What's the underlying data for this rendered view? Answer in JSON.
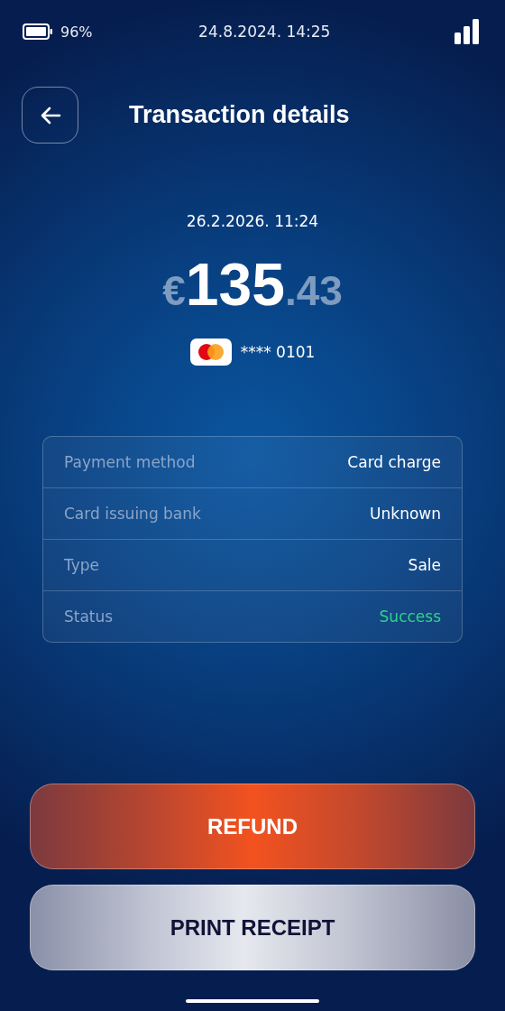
{
  "status_bar": {
    "battery": "96%",
    "datetime": "24.8.2024. 14:25"
  },
  "header": {
    "title": "Transaction details"
  },
  "transaction": {
    "datetime": "26.2.2026. 11:24",
    "currency": "€",
    "amount_whole": "135",
    "amount_fraction": ".43",
    "card_number": "**** 0101"
  },
  "details": [
    {
      "label": "Payment method",
      "value": "Card charge",
      "kind": "plain"
    },
    {
      "label": "Card issuing bank",
      "value": "Unknown",
      "kind": "plain"
    },
    {
      "label": "Type",
      "value": "Sale",
      "kind": "plain"
    },
    {
      "label": "Status",
      "value": "Success",
      "kind": "success"
    }
  ],
  "buttons": [
    {
      "label": "REFUND",
      "kind": "primary"
    },
    {
      "label": "PRINT RECEIPT",
      "kind": "secondary"
    }
  ]
}
